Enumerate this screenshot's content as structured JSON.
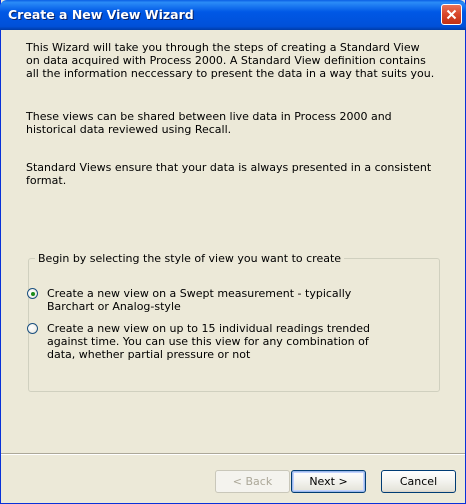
{
  "window": {
    "title": "Create a New View Wizard"
  },
  "intro": {
    "paragraph1": "This Wizard will take you through the steps of creating a Standard View on data acquired with Process 2000.  A Standard View definition contains all the information neccessary to present the data in a way that suits you.",
    "paragraph2": "These views can be shared between live data in Process 2000 and historical data reviewed using Recall.",
    "paragraph3": "Standard Views ensure that your data is always presented in a consistent format."
  },
  "group": {
    "legend": "Begin by selecting the style of view you want to create",
    "options": [
      {
        "label": "Create a new view on a Swept measurement - typically Barchart or Analog-style",
        "selected": true
      },
      {
        "label": "Create a new view on up to 15 individual readings trended against time. You can use this view for any combination of data, whether partial pressure or not",
        "selected": false
      }
    ]
  },
  "buttons": {
    "back": "< Back",
    "next": "Next >",
    "cancel": "Cancel"
  },
  "colors": {
    "titlebar": "#0058e6",
    "dialog_background": "#ece9d8",
    "close_button": "#d8462a",
    "radio_dot": "#1a8c1a"
  },
  "icons": {
    "close": "close-icon"
  }
}
